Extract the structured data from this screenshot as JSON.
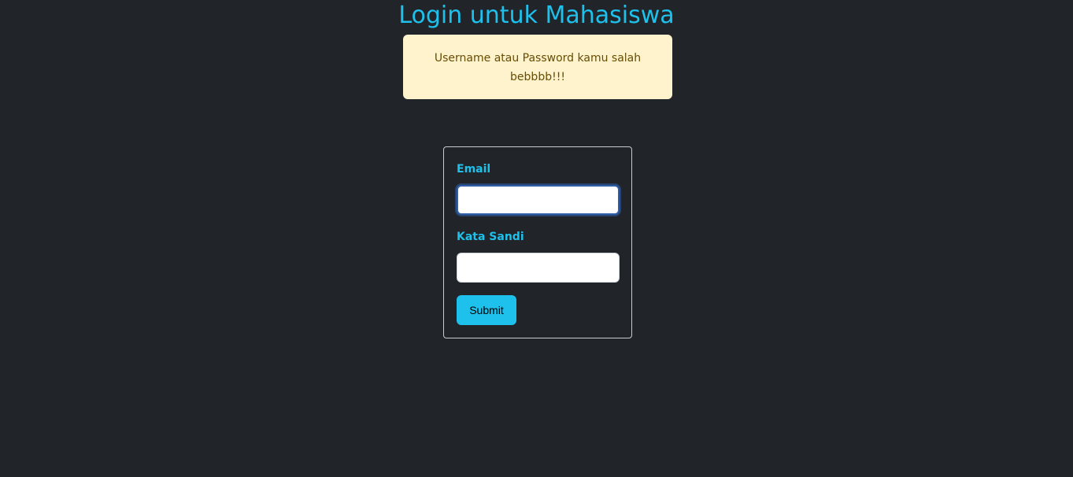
{
  "header": {
    "title": "Login untuk Mahasiswa"
  },
  "alert": {
    "message_line1": "Username atau Password kamu salah",
    "message_line2": "bebbbb!!!"
  },
  "form": {
    "email_label": "Email",
    "email_value": "",
    "password_label": "Kata Sandi",
    "password_value": "",
    "submit_label": "Submit"
  },
  "colors": {
    "background": "#212529",
    "accent": "#1ec1ec",
    "alert_bg": "#fff3cd",
    "alert_text": "#664d03",
    "focus_ring": "#2f5fa8"
  }
}
